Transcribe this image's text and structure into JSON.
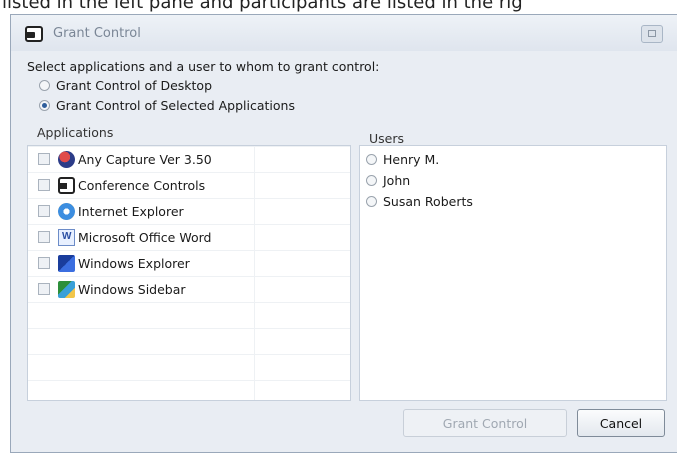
{
  "caption": "listed in the left pane and participants are listed in the rig",
  "dialog": {
    "title": "Grant Control",
    "prompt": "Select applications and a user to whom to grant control:",
    "options": [
      {
        "label": "Grant Control of Desktop",
        "selected": false
      },
      {
        "label": "Grant Control of Selected Applications",
        "selected": true
      }
    ],
    "applications_label": "Applications",
    "applications": [
      {
        "label": "Any Capture Ver 3.50",
        "icon": "any-capture-icon",
        "checked": false
      },
      {
        "label": "Conference Controls",
        "icon": "conference-controls-icon",
        "checked": false
      },
      {
        "label": "Internet Explorer",
        "icon": "internet-explorer-icon",
        "checked": false
      },
      {
        "label": "Microsoft Office Word",
        "icon": "word-icon",
        "checked": false
      },
      {
        "label": "Windows Explorer",
        "icon": "windows-explorer-icon",
        "checked": false
      },
      {
        "label": "Windows Sidebar",
        "icon": "windows-sidebar-icon",
        "checked": false
      }
    ],
    "users_label": "Users",
    "users": [
      {
        "label": "Henry M.",
        "selected": false
      },
      {
        "label": "John",
        "selected": false
      },
      {
        "label": "Susan Roberts",
        "selected": false
      }
    ],
    "grant_button": "Grant Control",
    "cancel_button": "Cancel"
  }
}
